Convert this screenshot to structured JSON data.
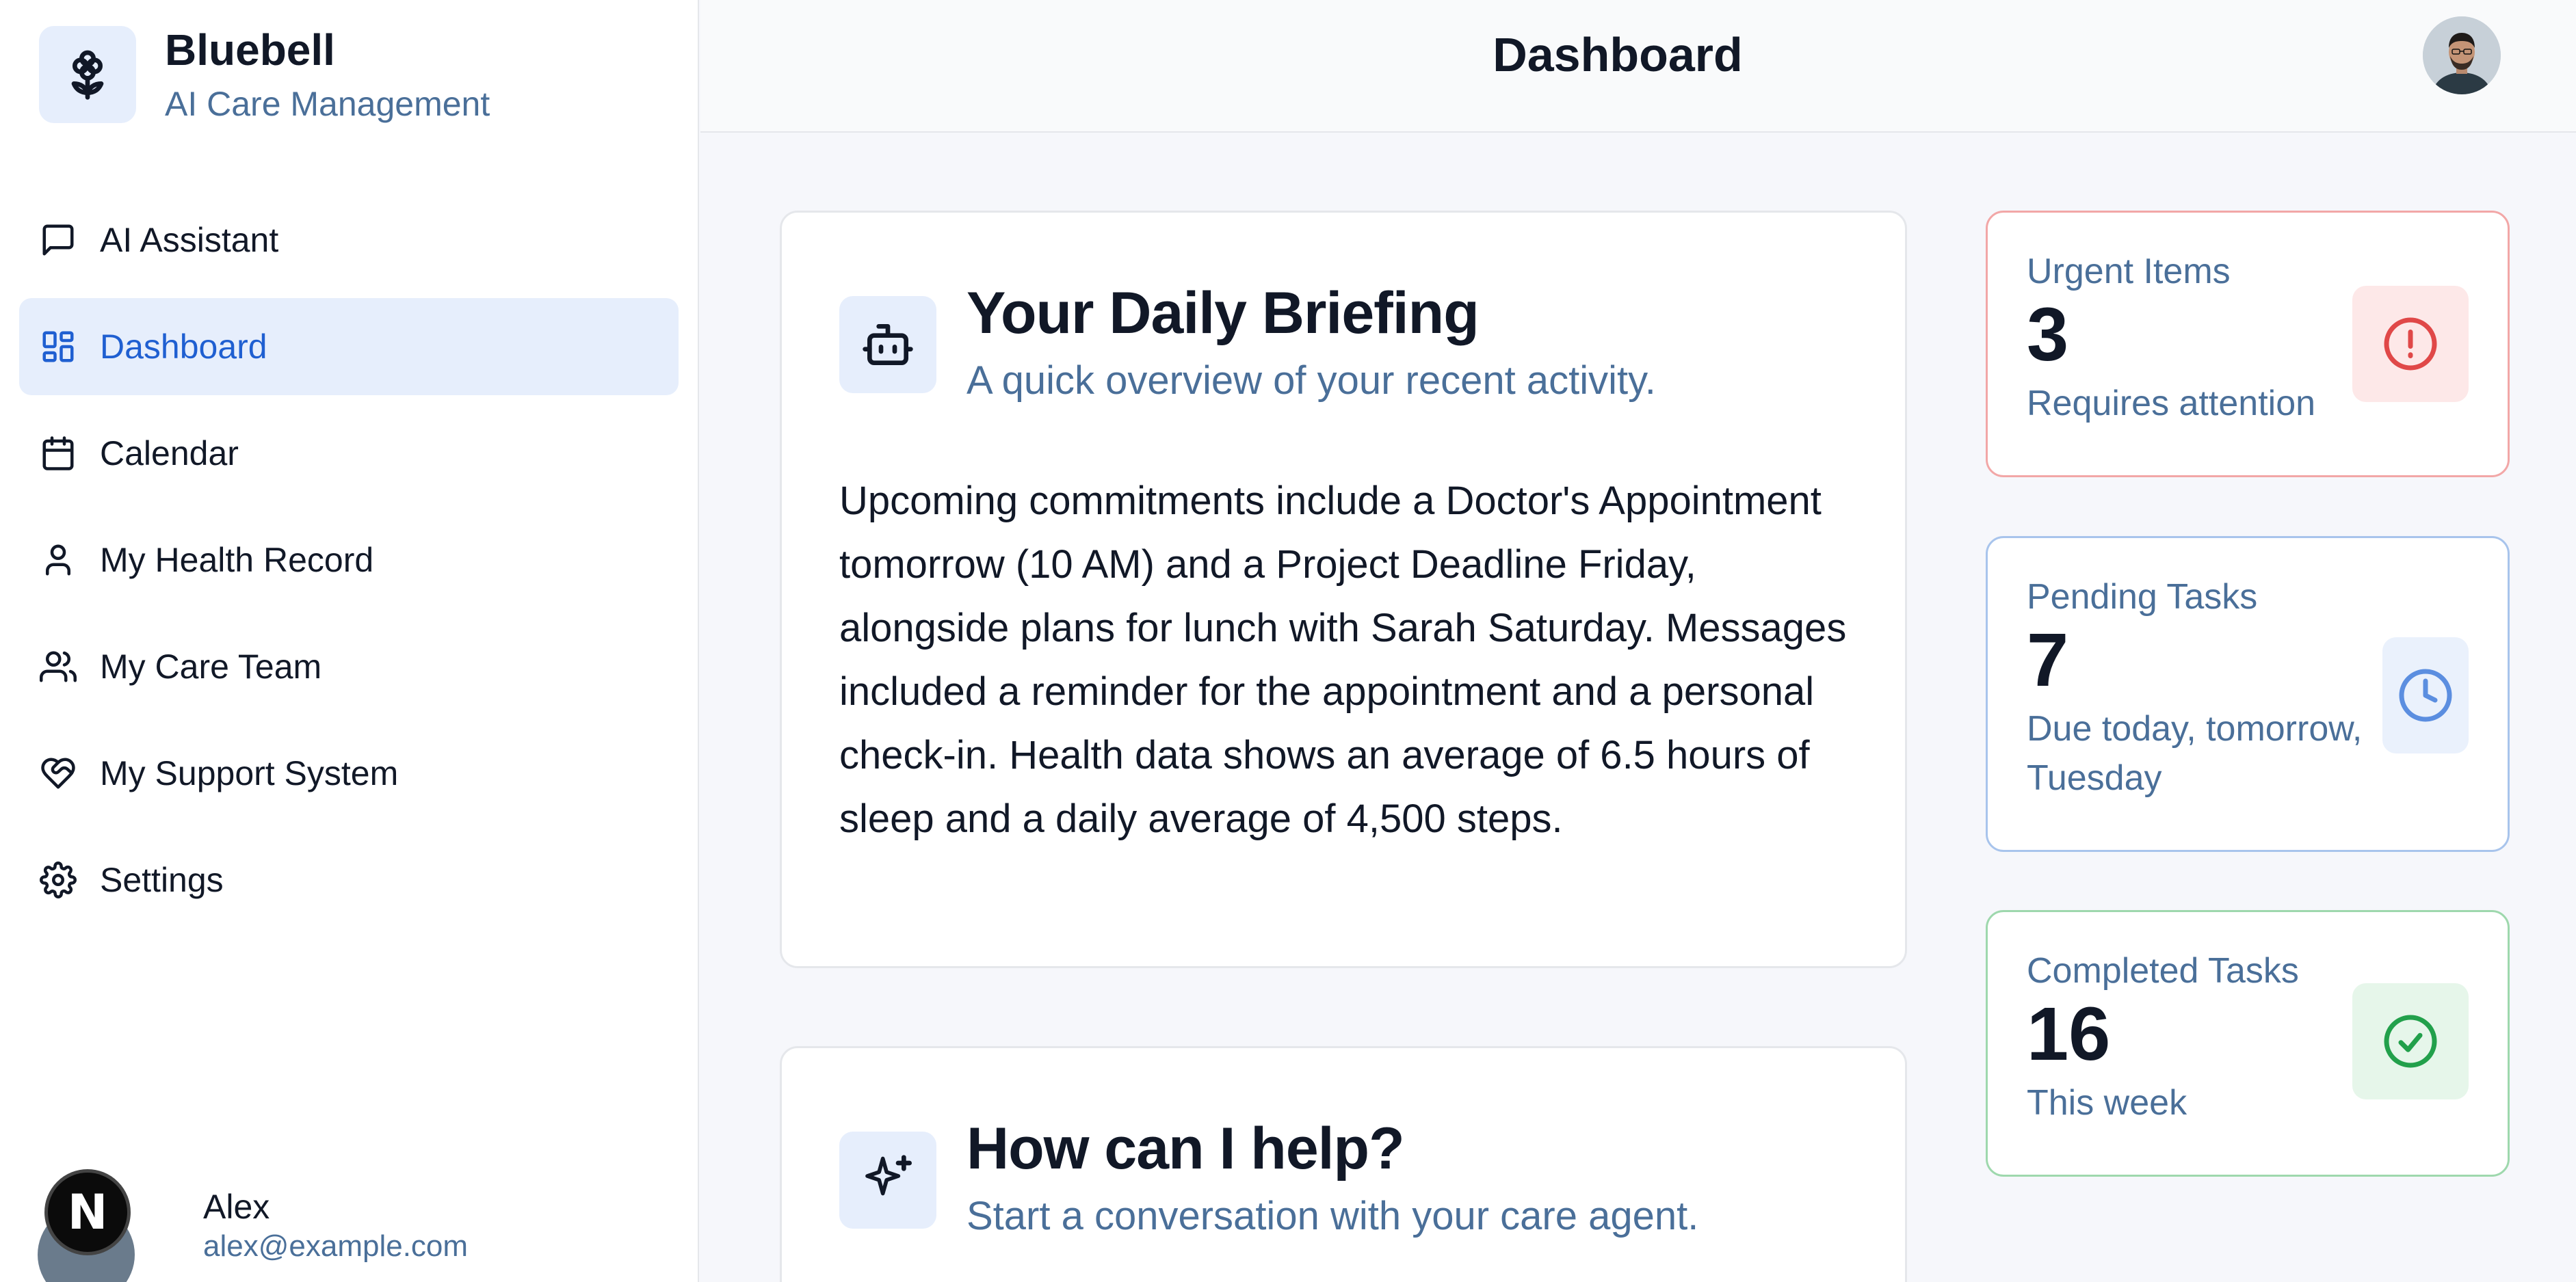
{
  "brand": {
    "name": "Bluebell",
    "subtitle": "AI Care Management",
    "logo_icon": "flower-icon"
  },
  "sidebar": {
    "items": [
      {
        "label": "AI Assistant",
        "icon": "message-icon",
        "active": false
      },
      {
        "label": "Dashboard",
        "icon": "layout-grid-icon",
        "active": true
      },
      {
        "label": "Calendar",
        "icon": "calendar-icon",
        "active": false
      },
      {
        "label": "My Health Record",
        "icon": "user-icon",
        "active": false
      },
      {
        "label": "My Care Team",
        "icon": "users-icon",
        "active": false
      },
      {
        "label": "My Support System",
        "icon": "heart-handshake-icon",
        "active": false
      },
      {
        "label": "Settings",
        "icon": "gear-icon",
        "active": false
      }
    ]
  },
  "user": {
    "name": "Alex",
    "email": "alex@example.com",
    "badge_letter": "N"
  },
  "header": {
    "title": "Dashboard"
  },
  "briefing": {
    "title": "Your Daily Briefing",
    "subtitle": "A quick overview of your recent activity.",
    "body": "Upcoming commitments include a Doctor's Appointment tomorrow (10 AM) and a Project Deadline Friday, alongside plans for lunch with Sarah Saturday. Messages included a reminder for the appointment and a personal check-in. Health data shows an average of 6.5 hours of sleep and a daily average of 4,500 steps."
  },
  "help": {
    "title": "How can I help?",
    "subtitle": "Start a conversation with your care agent."
  },
  "stats": {
    "urgent": {
      "label": "Urgent Items",
      "value": "3",
      "desc": "Requires attention",
      "color": "#e04848"
    },
    "pending": {
      "label": "Pending Tasks",
      "value": "7",
      "desc": "Due today, tomorrow, Tuesday",
      "color": "#5b8ee0"
    },
    "completed": {
      "label": "Completed Tasks",
      "value": "16",
      "desc": "This week",
      "color": "#22a04b"
    }
  },
  "colors": {
    "accent": "#1f5fd1",
    "accent_bg": "#e6eefc",
    "muted_text": "#4a6f99"
  }
}
